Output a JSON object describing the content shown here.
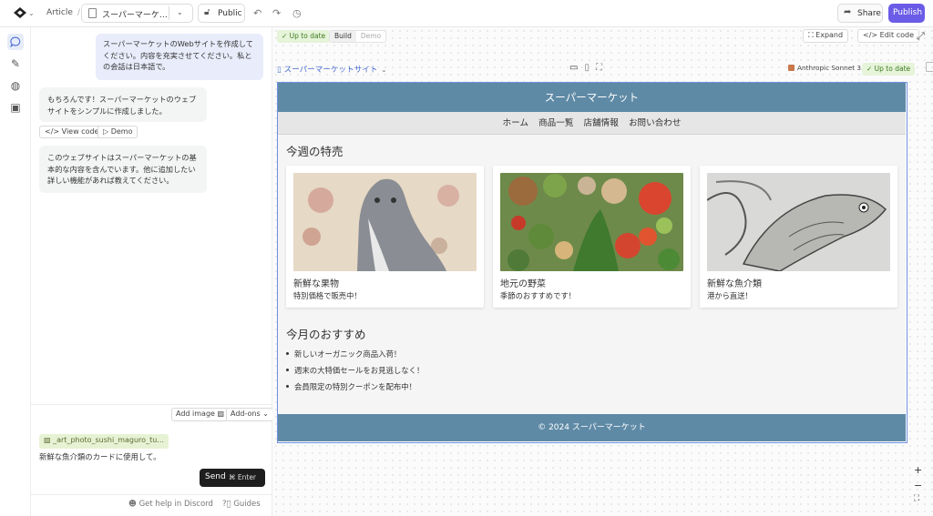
{
  "topbar": {
    "breadcrumb": "Article",
    "breadcrumb_sep": "/",
    "doc_title": "スーパーマーケ…",
    "visibility": "Public",
    "share": "Share",
    "publish": "Publish"
  },
  "chat": {
    "messages": [
      {
        "role": "user",
        "text": "スーパーマーケットのWebサイトを作成してください。内容を充実させてください。私との会話は日本語で。"
      },
      {
        "role": "assistant",
        "text": "もちろんです！スーパーマーケットのウェブサイトをシンプルに作成しました。"
      },
      {
        "role": "assistant",
        "text": "このウェブサイトはスーパーマーケットの基本的な内容を含んでいます。他に追加したい詳しい機能があれば教えてください。"
      }
    ],
    "view_code": "View code",
    "demo": "Demo",
    "add_image": "Add image",
    "add_ons": "Add-ons",
    "attachment": "_art_photo_sushi_maguro_tu...",
    "draft": "新鮮な魚介類のカードに使用して。",
    "send": "Send",
    "send_shortcut": "⌘  Enter",
    "help_discord": "Get help in Discord",
    "guides": "Guides"
  },
  "canvas": {
    "status": "Up to date",
    "tab_build": "Build",
    "tab_demo": "Demo",
    "expand": "Expand",
    "edit_code": "Edit code",
    "preview_title": "スーパーマーケットサイト",
    "model": "Anthropic Sonnet 3.5",
    "model_status": "Up to date",
    "zoom_in": "+",
    "zoom_out": "−"
  },
  "site": {
    "header": "スーパーマーケット",
    "nav": [
      "ホーム",
      "商品一覧",
      "店舗情報",
      "お問い合わせ"
    ],
    "specials_title": "今週の特売",
    "cards": [
      {
        "title": "新鮮な果物",
        "desc": "特別価格で販売中！"
      },
      {
        "title": "地元の野菜",
        "desc": "季節のおすすめです！"
      },
      {
        "title": "新鮮な魚介類",
        "desc": "港から直送！"
      }
    ],
    "recommend_title": "今月のおすすめ",
    "recommend": [
      "新しいオーガニック商品入荷！",
      "週末の大特価セールをお見逃しなく！",
      "会員限定の特別クーポンを配布中！"
    ],
    "footer": "© 2024 スーパーマーケット"
  },
  "colors": {
    "accent": "#6b5ce7",
    "site_primary": "#5f8aa6",
    "status_green": "#3d7a1f"
  }
}
